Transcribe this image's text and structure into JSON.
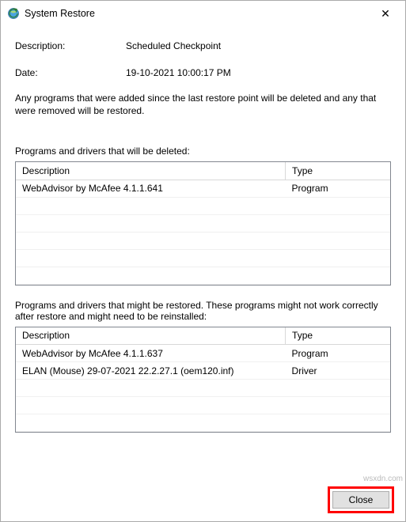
{
  "window": {
    "title": "System Restore",
    "close_glyph": "✕"
  },
  "meta": {
    "desc_label": "Description:",
    "desc_value": "Scheduled Checkpoint",
    "date_label": "Date:",
    "date_value": "19-10-2021 10:00:17 PM"
  },
  "explain_text": "Any programs that were added since the last restore point will be deleted and any that were removed will be restored.",
  "deleted": {
    "label": "Programs and drivers that will be deleted:",
    "col_desc": "Description",
    "col_type": "Type",
    "rows": [
      {
        "desc": "WebAdvisor by McAfee 4.1.1.641",
        "type": "Program"
      },
      {
        "desc": "",
        "type": ""
      },
      {
        "desc": "",
        "type": ""
      },
      {
        "desc": "",
        "type": ""
      },
      {
        "desc": "",
        "type": ""
      },
      {
        "desc": "",
        "type": ""
      }
    ]
  },
  "restored": {
    "label": "Programs and drivers that might be restored. These programs might not work correctly after restore and might need to be reinstalled:",
    "col_desc": "Description",
    "col_type": "Type",
    "rows": [
      {
        "desc": "WebAdvisor by McAfee 4.1.1.637",
        "type": "Program"
      },
      {
        "desc": "ELAN (Mouse) 29-07-2021 22.2.27.1 (oem120.inf)",
        "type": "Driver"
      },
      {
        "desc": "",
        "type": ""
      },
      {
        "desc": "",
        "type": ""
      },
      {
        "desc": "",
        "type": ""
      }
    ]
  },
  "footer": {
    "close_label": "Close"
  },
  "watermark": "wsxdn.com"
}
